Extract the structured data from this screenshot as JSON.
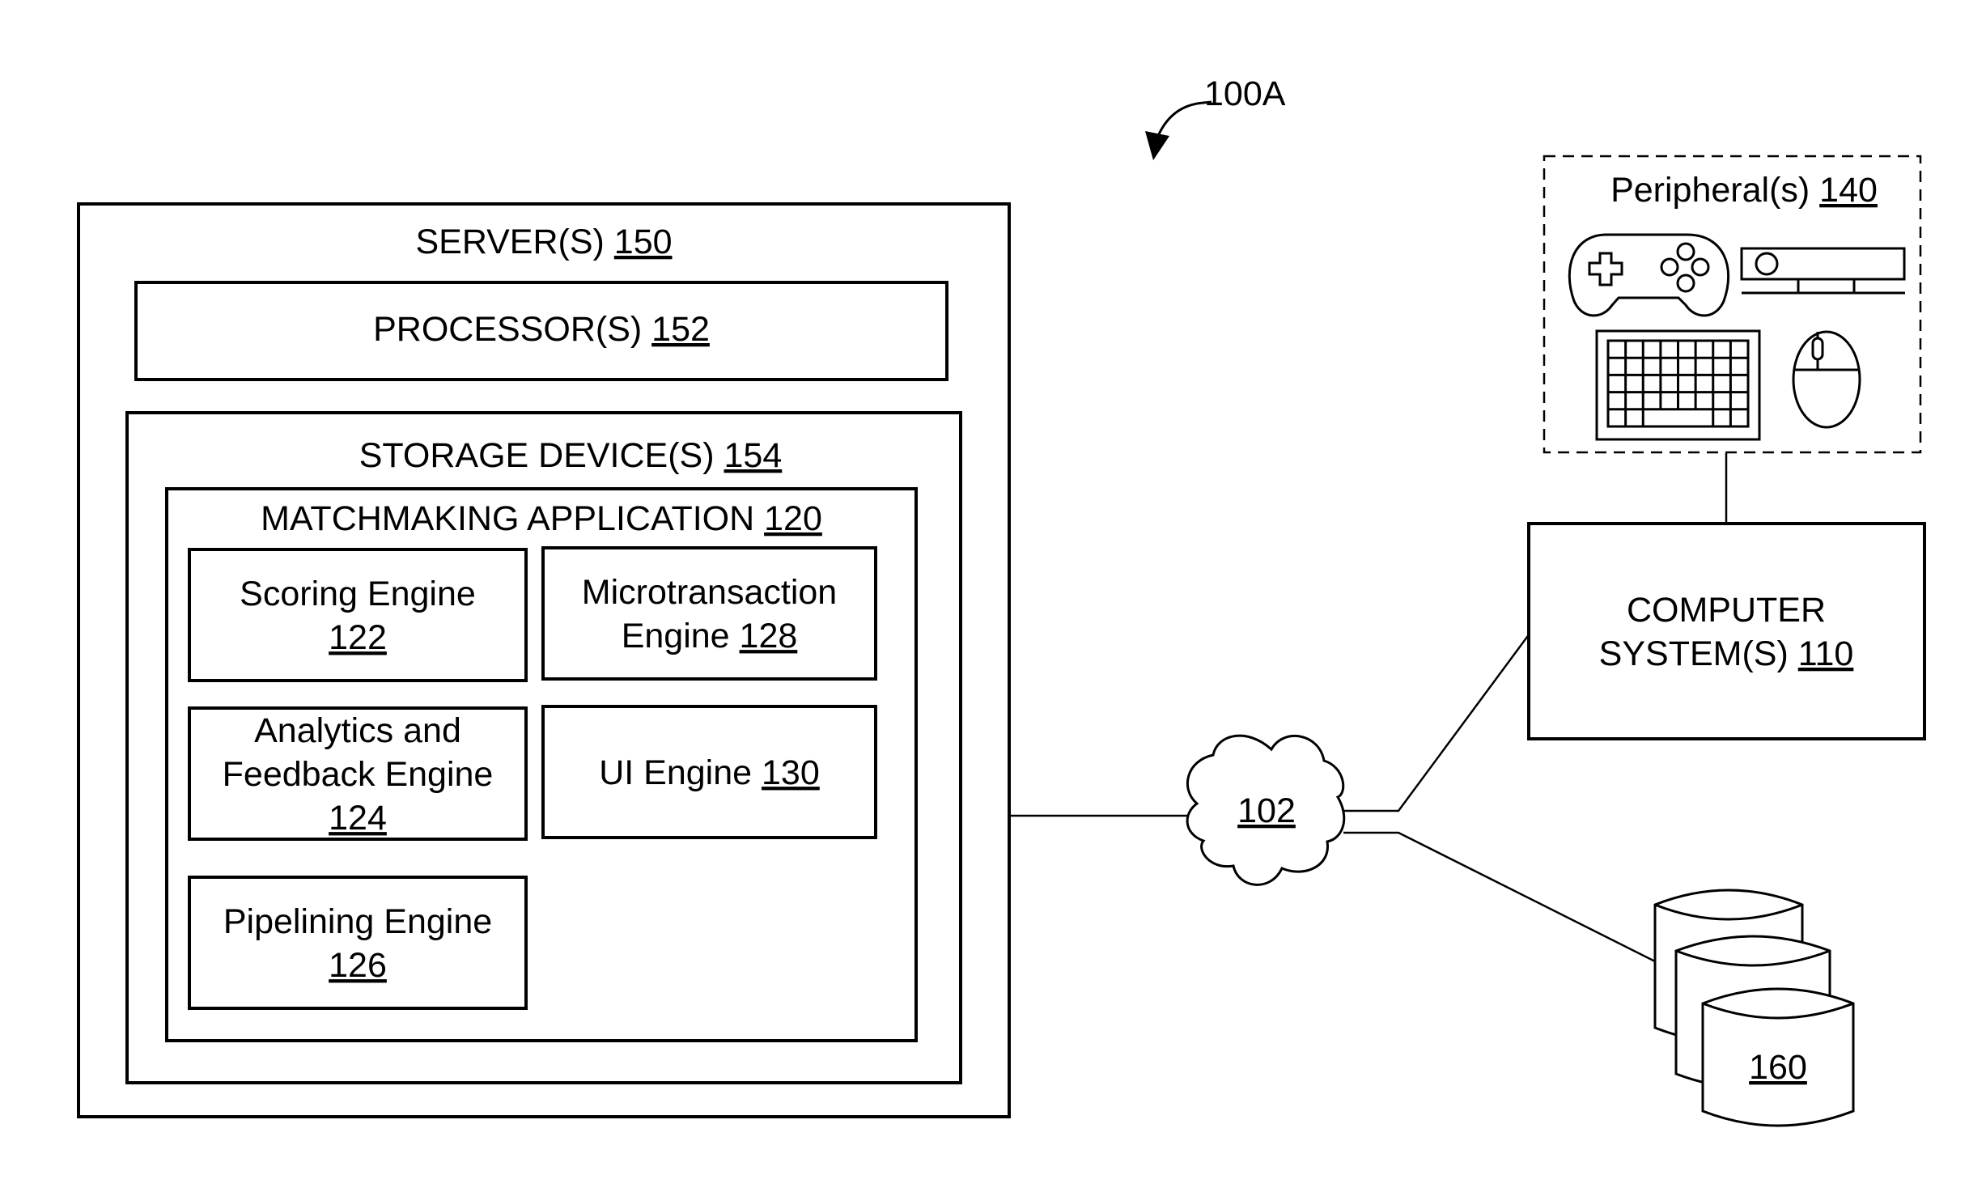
{
  "figure": {
    "reference_label": "100A"
  },
  "server": {
    "label": "SERVER(S)",
    "ref": "150",
    "processor": {
      "label": "PROCESSOR(S)",
      "ref": "152"
    },
    "storage": {
      "label": "STORAGE DEVICE(S)",
      "ref": "154",
      "application": {
        "label": "MATCHMAKING APPLICATION",
        "ref": "120",
        "engines": [
          {
            "lines": [
              "Scoring Engine"
            ],
            "ref": "122",
            "ref_on_own_line": true
          },
          {
            "lines": [
              "Microtransaction",
              "Engine"
            ],
            "ref": "128",
            "ref_on_own_line": false
          },
          {
            "lines": [
              "Analytics and",
              "Feedback Engine"
            ],
            "ref": "124",
            "ref_on_own_line": true
          },
          {
            "lines": [
              "UI Engine"
            ],
            "ref": "130",
            "ref_on_own_line": false
          },
          {
            "lines": [
              "Pipelining Engine"
            ],
            "ref": "126",
            "ref_on_own_line": true
          }
        ]
      }
    }
  },
  "network": {
    "ref": "102",
    "icon": "cloud-icon"
  },
  "computer_system": {
    "lines": [
      "COMPUTER",
      "SYSTEM(S)"
    ],
    "ref": "110"
  },
  "peripherals": {
    "label": "Peripheral(s)",
    "ref": "140",
    "items": [
      {
        "name": "gamepad",
        "icon": "gamepad-icon"
      },
      {
        "name": "sensor-bar",
        "icon": "camera-sensor-icon"
      },
      {
        "name": "keyboard",
        "icon": "keyboard-icon"
      },
      {
        "name": "mouse",
        "icon": "mouse-icon"
      }
    ]
  },
  "database": {
    "ref": "160",
    "icon": "database-icon"
  }
}
